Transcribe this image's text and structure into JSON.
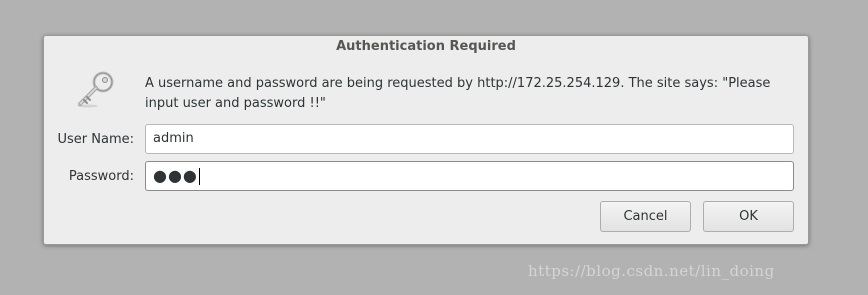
{
  "dialog": {
    "title": "Authentication Required",
    "message": "A username and password are being requested by http://172.25.254.129. The site says: \"Please input user and password !!\"",
    "username_label": "User Name:",
    "username_value": "admin",
    "password_label": "Password:",
    "password_mask": "●●●",
    "cancel_label": "Cancel",
    "ok_label": "OK",
    "icon": "key-icon"
  },
  "watermark": "https://blog.csdn.net/lin_doing"
}
